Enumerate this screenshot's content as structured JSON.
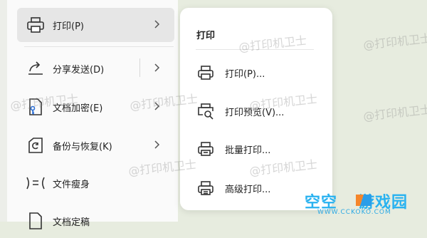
{
  "left_menu": {
    "items": [
      {
        "label": "打印(P)",
        "icon": "printer-icon",
        "has_submenu": true,
        "active": true
      },
      {
        "label": "分享发送(D)",
        "icon": "share-icon",
        "has_submenu": true
      },
      {
        "label": "文档加密(E)",
        "icon": "encrypt-document-icon",
        "has_submenu": true
      },
      {
        "label": "备份与恢复(K)",
        "icon": "backup-restore-icon",
        "has_submenu": true
      },
      {
        "label": "文件瘦身",
        "icon": "slim-file-icon",
        "has_submenu": false
      },
      {
        "label": "文档定稿",
        "icon": "finalize-document-icon",
        "has_submenu": false
      }
    ]
  },
  "submenu": {
    "title": "打印",
    "items": [
      {
        "label": "打印(P)...",
        "icon": "printer-icon"
      },
      {
        "label": "打印预览(V)...",
        "icon": "print-preview-icon"
      },
      {
        "label": "批量打印...",
        "icon": "batch-print-icon"
      },
      {
        "label": "高级打印...",
        "icon": "advanced-print-icon"
      }
    ]
  },
  "watermark_text": "@打印机卫士",
  "brand": {
    "name": "空空",
    "name_suffix": "游戏园",
    "url": "WWW.CCKOKO.COM",
    "colors": {
      "text": "#29b2f0",
      "logo_orange": "#f5862a",
      "logo_blue": "#2b9de8"
    }
  },
  "colors": {
    "background": "#e7ecdf",
    "panel": "#fafafa",
    "active_item": "#e6e6e6",
    "submenu_bg": "#ffffff"
  }
}
